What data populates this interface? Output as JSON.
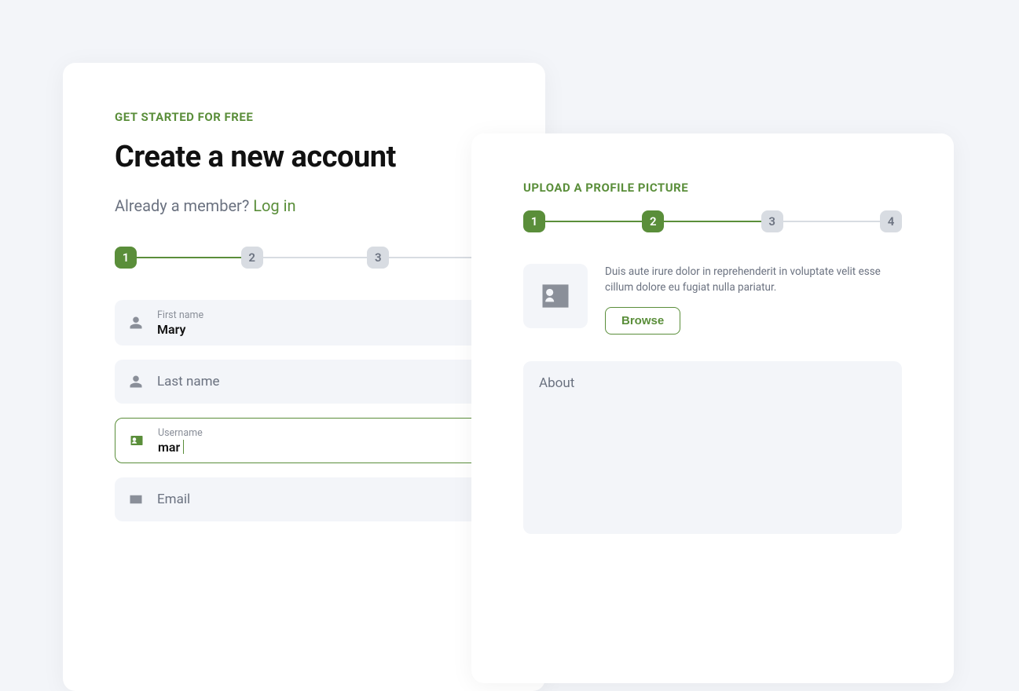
{
  "colors": {
    "accent": "#5a8e3a",
    "muted": "#6b7280",
    "fieldbg": "#f3f5f9"
  },
  "left": {
    "eyebrow": "GET STARTED FOR FREE",
    "heading": "Create a new account",
    "already": "Already a member? ",
    "login": "Log in",
    "steps": [
      "1",
      "2",
      "3"
    ],
    "active_step": 1,
    "fields": {
      "first_name": {
        "label": "First name",
        "value": "Mary"
      },
      "last_name": {
        "placeholder": "Last name"
      },
      "username": {
        "label": "Username",
        "value": "mar"
      },
      "email": {
        "placeholder": "Email"
      }
    }
  },
  "right": {
    "eyebrow": "UPLOAD A PROFILE PICTURE",
    "steps": [
      "1",
      "2",
      "3",
      "4"
    ],
    "active_step": 2,
    "upload_desc": "Duis aute irure dolor in reprehenderit in voluptate velit esse cillum dolore eu fugiat nulla pariatur.",
    "browse_label": "Browse",
    "about_placeholder": "About"
  }
}
